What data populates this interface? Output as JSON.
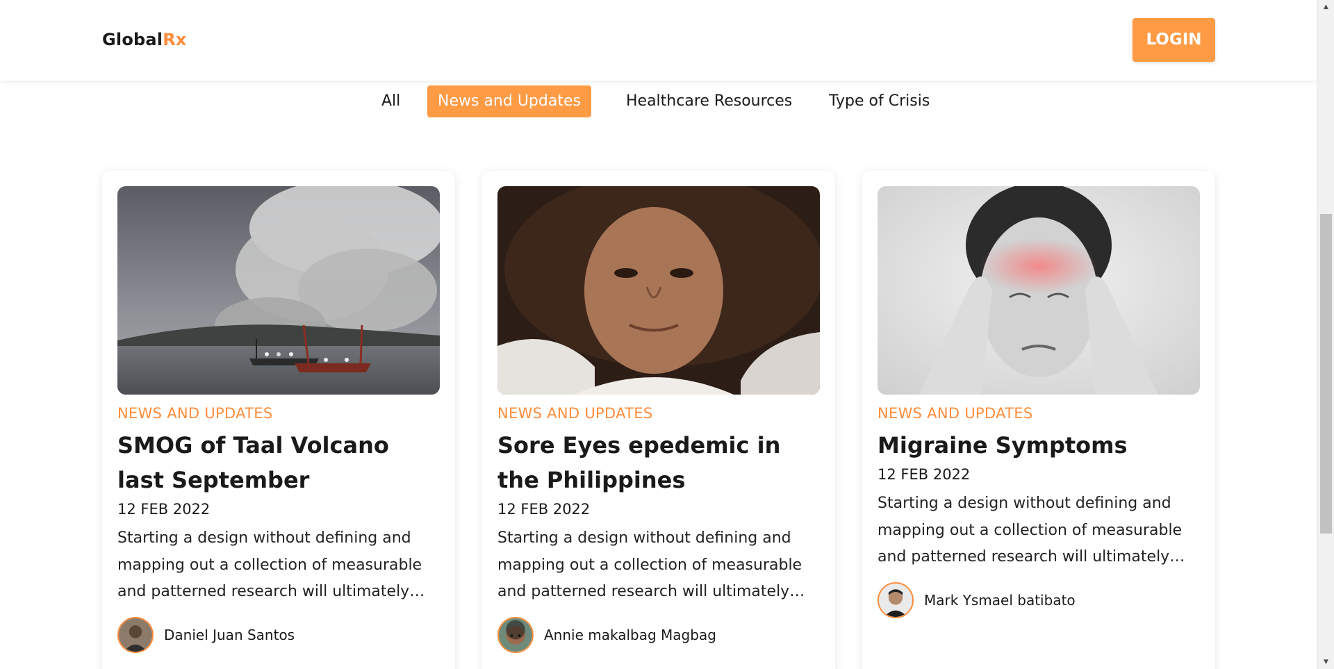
{
  "header": {
    "logo_main": "Global",
    "logo_accent": "Rx",
    "login_label": "LOGIN"
  },
  "tabs": [
    {
      "label": "All",
      "active": false
    },
    {
      "label": "News and Updates",
      "active": true
    },
    {
      "label": "Healthcare Resources",
      "active": false
    },
    {
      "label": "Type of Crisis",
      "active": false
    }
  ],
  "cards": [
    {
      "image": "taal-volcano-smog-photo",
      "category": "NEWS AND UPDATES",
      "title": "SMOG of Taal Volcano last September",
      "date": "12 FEB 2022",
      "excerpt": "Starting a design without defining and mapping out a collection of measurable and patterned research will ultimately…",
      "author": "Daniel Juan Santos"
    },
    {
      "image": "sore-eyes-portrait-photo",
      "category": "NEWS AND UPDATES",
      "title": "Sore Eyes epedemic in the Philippines",
      "date": "12 FEB 2022",
      "excerpt": "Starting a design without defining and mapping out a collection of measurable and patterned research will ultimately…",
      "author": "Annie makalbag Magbag"
    },
    {
      "image": "migraine-woman-photo",
      "category": "NEWS AND UPDATES",
      "title": "Migraine Symptoms",
      "date": "12 FEB 2022",
      "excerpt": "Starting a design without defining and mapping out a collection of measurable and patterned research will ultimately…",
      "author": "Mark Ysmael batibato"
    }
  ],
  "colors": {
    "accent": "#ff9a45",
    "accent_text": "#ff8c3a",
    "text": "#1a1a1a"
  }
}
